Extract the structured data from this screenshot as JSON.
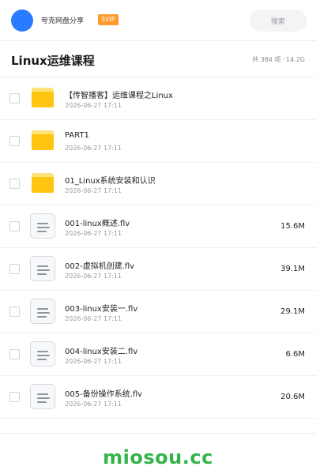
{
  "header": {
    "app_name": "夸克网盘分享",
    "badge": "SVIP",
    "search_placeholder": "搜索"
  },
  "folder": {
    "title": "Linux运维课程",
    "summary_count": "共 384 项",
    "summary_sep": "·",
    "summary_size": "14.2G"
  },
  "items": [
    {
      "type": "folder",
      "name": "【传智播客】运维课程之Linux",
      "date": "2026-06-27 17:11",
      "size": ""
    },
    {
      "type": "folder",
      "name": "PART1",
      "date": "2026-06-27 17:11",
      "size": ""
    },
    {
      "type": "folder",
      "name": "01_Linux系统安装和认识",
      "date": "2026-06-27 17:11",
      "size": ""
    },
    {
      "type": "file",
      "name": "001-linux概述.flv",
      "date": "2026-06-27 17:11",
      "size": "15.6M"
    },
    {
      "type": "file",
      "name": "002-虚拟机创建.flv",
      "date": "2026-06-27 17:11",
      "size": "39.1M"
    },
    {
      "type": "file",
      "name": "003-linux安装一.flv",
      "date": "2026-06-27 17:11",
      "size": "29.1M"
    },
    {
      "type": "file",
      "name": "004-linux安装二.flv",
      "date": "2026-06-27 17:11",
      "size": "6.6M"
    },
    {
      "type": "file",
      "name": "005-备份操作系统.flv",
      "date": "2026-06-27 17:11",
      "size": "20.6M"
    }
  ],
  "footer": {
    "watermark": "miosou.cc"
  },
  "colors": {
    "accent_blue": "#2a7bff",
    "svip_orange": "#ff9a2e",
    "folder_yellow": "#ffc510",
    "watermark_green": "#34b44a"
  }
}
